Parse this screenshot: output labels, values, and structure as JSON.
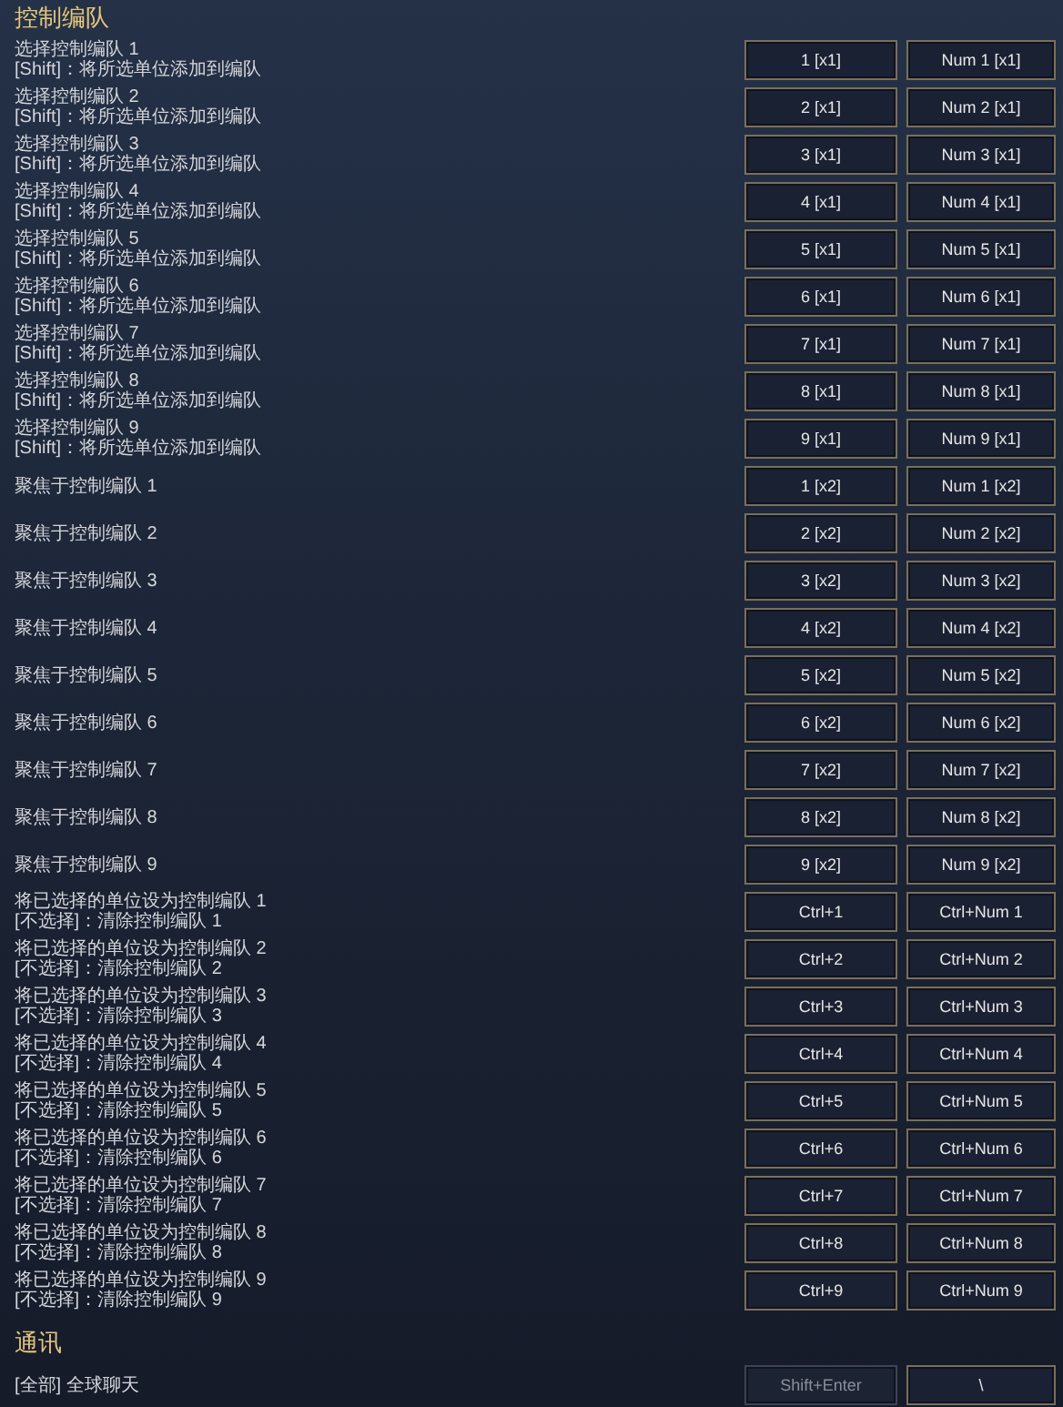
{
  "sections": [
    {
      "title": "控制编队",
      "rows": [
        {
          "lines": [
            "选择控制编队 1",
            "[Shift]：将所选单位添加到编队"
          ],
          "keys": [
            {
              "label": "1 [x1]",
              "disabled": false
            },
            {
              "label": "Num 1 [x1]",
              "disabled": false
            }
          ]
        },
        {
          "lines": [
            "选择控制编队 2",
            "[Shift]：将所选单位添加到编队"
          ],
          "keys": [
            {
              "label": "2 [x1]",
              "disabled": false
            },
            {
              "label": "Num 2 [x1]",
              "disabled": false
            }
          ]
        },
        {
          "lines": [
            "选择控制编队 3",
            "[Shift]：将所选单位添加到编队"
          ],
          "keys": [
            {
              "label": "3 [x1]",
              "disabled": false
            },
            {
              "label": "Num 3 [x1]",
              "disabled": false
            }
          ]
        },
        {
          "lines": [
            "选择控制编队 4",
            "[Shift]：将所选单位添加到编队"
          ],
          "keys": [
            {
              "label": "4 [x1]",
              "disabled": false
            },
            {
              "label": "Num 4 [x1]",
              "disabled": false
            }
          ]
        },
        {
          "lines": [
            "选择控制编队 5",
            "[Shift]：将所选单位添加到编队"
          ],
          "keys": [
            {
              "label": "5 [x1]",
              "disabled": false
            },
            {
              "label": "Num 5 [x1]",
              "disabled": false
            }
          ]
        },
        {
          "lines": [
            "选择控制编队 6",
            "[Shift]：将所选单位添加到编队"
          ],
          "keys": [
            {
              "label": "6 [x1]",
              "disabled": false
            },
            {
              "label": "Num 6 [x1]",
              "disabled": false
            }
          ]
        },
        {
          "lines": [
            "选择控制编队 7",
            "[Shift]：将所选单位添加到编队"
          ],
          "keys": [
            {
              "label": "7 [x1]",
              "disabled": false
            },
            {
              "label": "Num 7 [x1]",
              "disabled": false
            }
          ]
        },
        {
          "lines": [
            "选择控制编队 8",
            "[Shift]：将所选单位添加到编队"
          ],
          "keys": [
            {
              "label": "8 [x1]",
              "disabled": false
            },
            {
              "label": "Num 8 [x1]",
              "disabled": false
            }
          ]
        },
        {
          "lines": [
            "选择控制编队 9",
            "[Shift]：将所选单位添加到编队"
          ],
          "keys": [
            {
              "label": "9 [x1]",
              "disabled": false
            },
            {
              "label": "Num 9 [x1]",
              "disabled": false
            }
          ]
        },
        {
          "lines": [
            "聚焦于控制编队 1"
          ],
          "keys": [
            {
              "label": "1 [x2]",
              "disabled": false
            },
            {
              "label": "Num 1 [x2]",
              "disabled": false
            }
          ]
        },
        {
          "lines": [
            "聚焦于控制编队 2"
          ],
          "keys": [
            {
              "label": "2 [x2]",
              "disabled": false
            },
            {
              "label": "Num 2 [x2]",
              "disabled": false
            }
          ]
        },
        {
          "lines": [
            "聚焦于控制编队 3"
          ],
          "keys": [
            {
              "label": "3 [x2]",
              "disabled": false
            },
            {
              "label": "Num 3 [x2]",
              "disabled": false
            }
          ]
        },
        {
          "lines": [
            "聚焦于控制编队 4"
          ],
          "keys": [
            {
              "label": "4 [x2]",
              "disabled": false
            },
            {
              "label": "Num 4 [x2]",
              "disabled": false
            }
          ]
        },
        {
          "lines": [
            "聚焦于控制编队 5"
          ],
          "keys": [
            {
              "label": "5 [x2]",
              "disabled": false
            },
            {
              "label": "Num 5 [x2]",
              "disabled": false
            }
          ]
        },
        {
          "lines": [
            "聚焦于控制编队 6"
          ],
          "keys": [
            {
              "label": "6 [x2]",
              "disabled": false
            },
            {
              "label": "Num 6 [x2]",
              "disabled": false
            }
          ]
        },
        {
          "lines": [
            "聚焦于控制编队 7"
          ],
          "keys": [
            {
              "label": "7 [x2]",
              "disabled": false
            },
            {
              "label": "Num 7 [x2]",
              "disabled": false
            }
          ]
        },
        {
          "lines": [
            "聚焦于控制编队 8"
          ],
          "keys": [
            {
              "label": "8 [x2]",
              "disabled": false
            },
            {
              "label": "Num 8 [x2]",
              "disabled": false
            }
          ]
        },
        {
          "lines": [
            "聚焦于控制编队 9"
          ],
          "keys": [
            {
              "label": "9 [x2]",
              "disabled": false
            },
            {
              "label": "Num 9 [x2]",
              "disabled": false
            }
          ]
        },
        {
          "lines": [
            "将已选择的单位设为控制编队 1",
            "[不选择]：清除控制编队 1"
          ],
          "keys": [
            {
              "label": "Ctrl+1",
              "disabled": false
            },
            {
              "label": "Ctrl+Num 1",
              "disabled": false
            }
          ]
        },
        {
          "lines": [
            "将已选择的单位设为控制编队 2",
            "[不选择]：清除控制编队 2"
          ],
          "keys": [
            {
              "label": "Ctrl+2",
              "disabled": false
            },
            {
              "label": "Ctrl+Num 2",
              "disabled": false
            }
          ]
        },
        {
          "lines": [
            "将已选择的单位设为控制编队 3",
            "[不选择]：清除控制编队 3"
          ],
          "keys": [
            {
              "label": "Ctrl+3",
              "disabled": false
            },
            {
              "label": "Ctrl+Num 3",
              "disabled": false
            }
          ]
        },
        {
          "lines": [
            "将已选择的单位设为控制编队 4",
            "[不选择]：清除控制编队 4"
          ],
          "keys": [
            {
              "label": "Ctrl+4",
              "disabled": false
            },
            {
              "label": "Ctrl+Num 4",
              "disabled": false
            }
          ]
        },
        {
          "lines": [
            "将已选择的单位设为控制编队 5",
            "[不选择]：清除控制编队 5"
          ],
          "keys": [
            {
              "label": "Ctrl+5",
              "disabled": false
            },
            {
              "label": "Ctrl+Num 5",
              "disabled": false
            }
          ]
        },
        {
          "lines": [
            "将已选择的单位设为控制编队 6",
            "[不选择]：清除控制编队 6"
          ],
          "keys": [
            {
              "label": "Ctrl+6",
              "disabled": false
            },
            {
              "label": "Ctrl+Num 6",
              "disabled": false
            }
          ]
        },
        {
          "lines": [
            "将已选择的单位设为控制编队 7",
            "[不选择]：清除控制编队 7"
          ],
          "keys": [
            {
              "label": "Ctrl+7",
              "disabled": false
            },
            {
              "label": "Ctrl+Num 7",
              "disabled": false
            }
          ]
        },
        {
          "lines": [
            "将已选择的单位设为控制编队 8",
            "[不选择]：清除控制编队 8"
          ],
          "keys": [
            {
              "label": "Ctrl+8",
              "disabled": false
            },
            {
              "label": "Ctrl+Num 8",
              "disabled": false
            }
          ]
        },
        {
          "lines": [
            "将已选择的单位设为控制编队 9",
            "[不选择]：清除控制编队 9"
          ],
          "keys": [
            {
              "label": "Ctrl+9",
              "disabled": false
            },
            {
              "label": "Ctrl+Num 9",
              "disabled": false
            }
          ]
        }
      ]
    },
    {
      "title": "通讯",
      "rows": [
        {
          "lines": [
            "[全部] 全球聊天"
          ],
          "keys": [
            {
              "label": "Shift+Enter",
              "disabled": true
            },
            {
              "label": "\\",
              "disabled": false
            }
          ]
        }
      ]
    }
  ]
}
